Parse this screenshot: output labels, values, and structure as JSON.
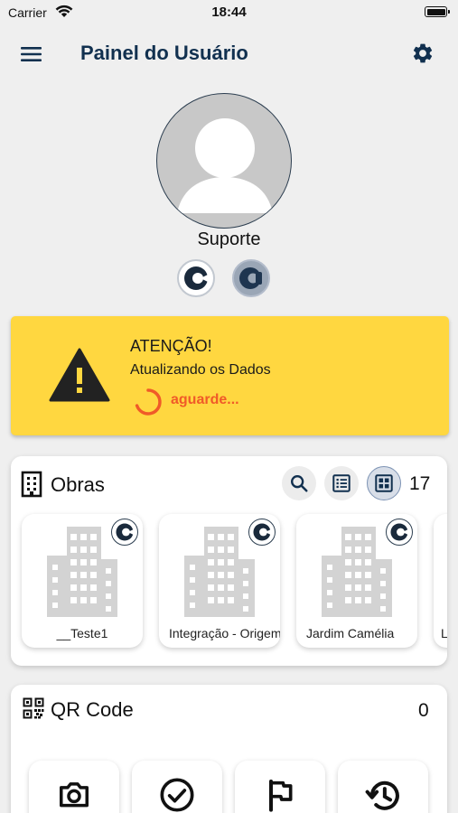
{
  "status_bar": {
    "carrier": "Carrier",
    "time": "18:44"
  },
  "header": {
    "title": "Painel do Usuário",
    "menu_icon": "menu-icon",
    "settings_icon": "gear-icon"
  },
  "profile": {
    "name": "Suporte"
  },
  "alert": {
    "title": "ATENÇÃO!",
    "message": "Atualizando os Dados",
    "wait_text": "aguarde...",
    "background": "#ffd740",
    "wait_color": "#f05a28"
  },
  "obras": {
    "title": "Obras",
    "count": "17",
    "items": [
      {
        "label": "__Teste1"
      },
      {
        "label": "Integração - Origem"
      },
      {
        "label": "Jardim Camélia"
      },
      {
        "label": "L"
      }
    ]
  },
  "qr": {
    "title": "QR Code",
    "count": "0",
    "actions": [
      "camera-icon",
      "check-circle-icon",
      "flag-icon",
      "history-icon"
    ]
  },
  "colors": {
    "brand_dark": "#11304f",
    "background": "#efefef"
  }
}
